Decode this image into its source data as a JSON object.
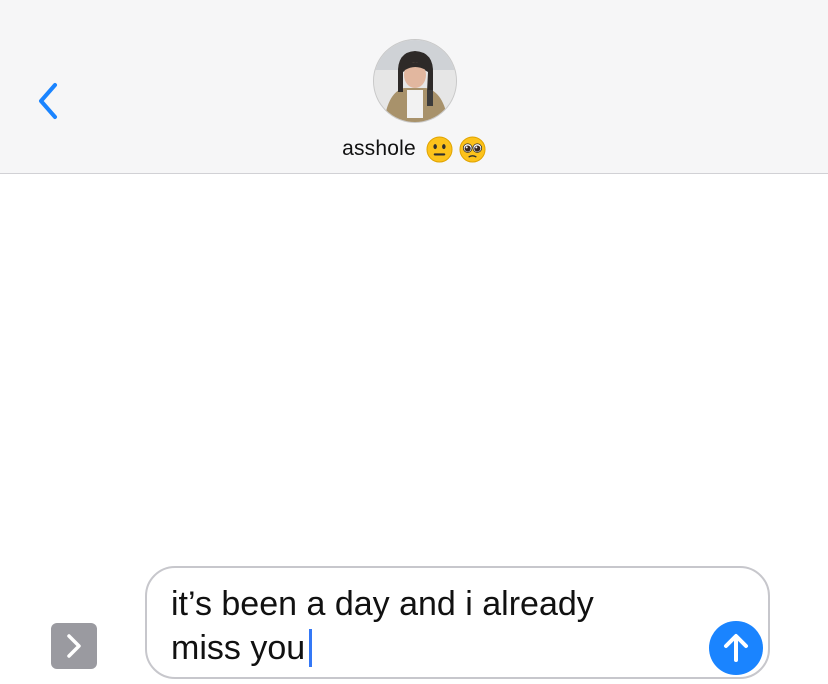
{
  "header": {
    "contact_name": "asshole",
    "contact_emojis": [
      "neutral-face-emoji",
      "pleading-face-emoji"
    ],
    "back_icon": "chevron-left-icon",
    "avatar": "contact-photo"
  },
  "composer": {
    "message_text": "it’s been a day and i already\nmiss you",
    "apps_icon": "chevron-right-icon",
    "send_icon": "arrow-up-icon"
  },
  "colors": {
    "accent": "#1a84ff",
    "header_bg": "#f6f6f7",
    "apps_button": "#9a9aa0",
    "caret": "#3478f6"
  }
}
